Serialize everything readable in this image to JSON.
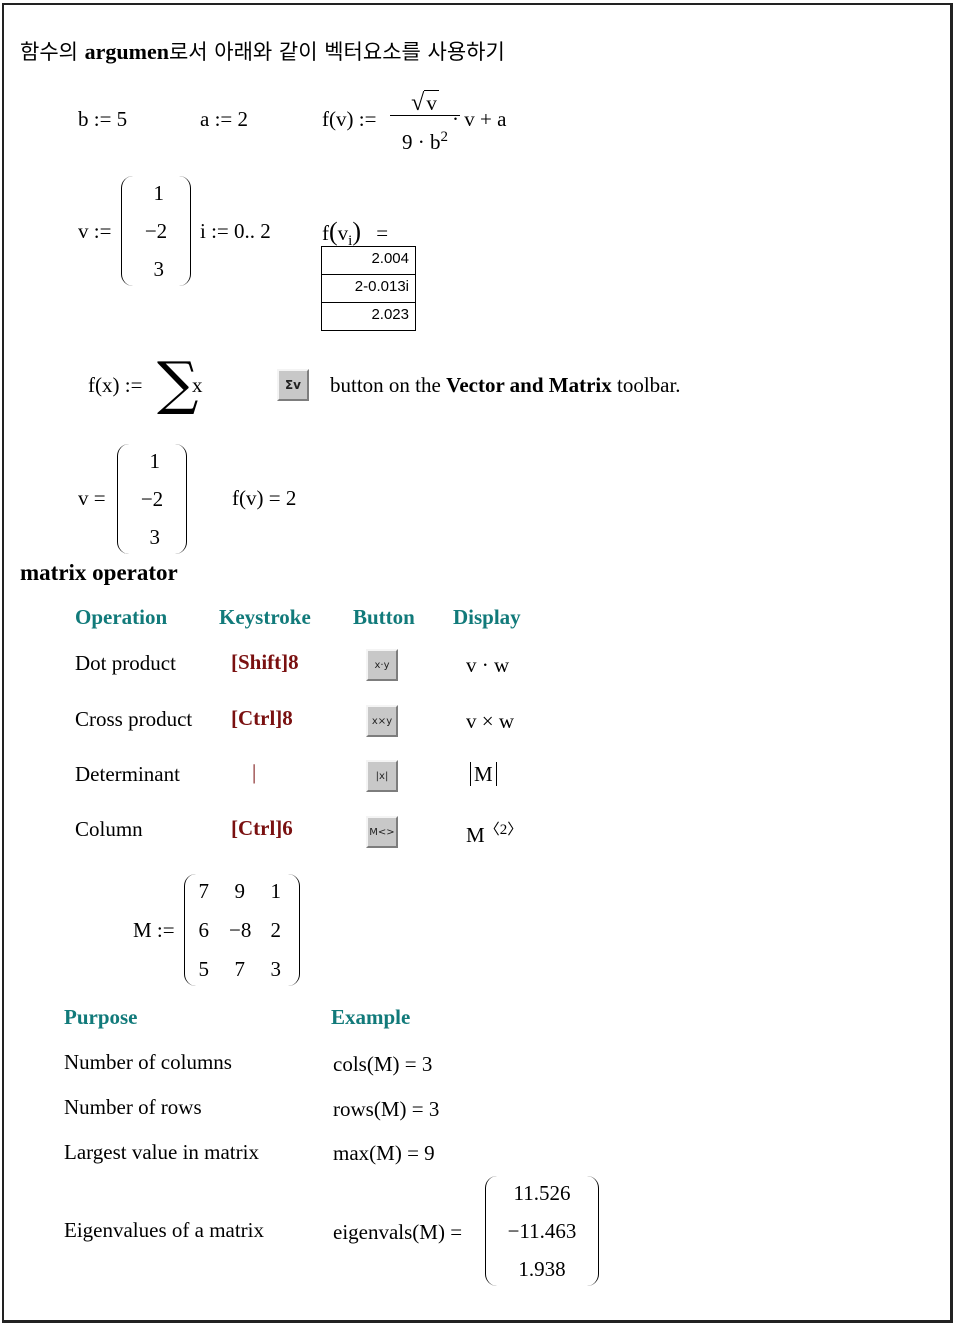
{
  "heading": {
    "prefix": "함수의 ",
    "bold": "argumen",
    "suffix": "로서 아래와 같이 벡터요소를 사용하기"
  },
  "definitions": {
    "b": "b := 5",
    "a": "a := 2",
    "f_lhs": "f(v) :=",
    "f_num": "v",
    "f_den": "9 · b",
    "f_den_exp": "2",
    "f_tail": "· v + a"
  },
  "vector_def": {
    "lhs": "v :=",
    "values": [
      "1",
      "−2",
      "3"
    ],
    "range": "i := 0.. 2",
    "f_call": "f",
    "f_arg": "v",
    "f_sub": "i",
    "eq": "="
  },
  "results": [
    "2.004",
    "2-0.013i",
    "2.023"
  ],
  "sum_line": {
    "lhs": "f(x) :=",
    "sigma": "∑",
    "var": "x",
    "button_icon": "Σv",
    "text_pre": "button on the ",
    "text_bold": "Vector and Matrix",
    "text_post": " toolbar."
  },
  "vector_eval": {
    "lhs": "v =",
    "values": [
      "1",
      "−2",
      "3"
    ],
    "f_result": "f(v) = 2"
  },
  "section_title": "matrix operator",
  "operators_table": {
    "headers": [
      "Operation",
      "Keystroke",
      "Button",
      "Display"
    ],
    "rows": [
      {
        "operation": "Dot product",
        "keystroke": "[Shift]8",
        "button_icon": "x·y",
        "display": "v · w"
      },
      {
        "operation": "Cross product",
        "keystroke": "[Ctrl]8",
        "button_icon": "x×y",
        "display": "v × w"
      },
      {
        "operation": "Determinant",
        "keystroke": "|",
        "button_icon": "|x|",
        "display": "M"
      },
      {
        "operation": "Column",
        "keystroke": "[Ctrl]6",
        "button_icon": "M<>",
        "display": "M",
        "display_sup": "〈2〉"
      }
    ]
  },
  "matrix_def": {
    "lhs": "M :=",
    "rows": [
      [
        "7",
        "9",
        "1"
      ],
      [
        "6",
        "−8",
        "2"
      ],
      [
        "5",
        "7",
        "3"
      ]
    ]
  },
  "functions_table": {
    "headers": [
      "Purpose",
      "Example"
    ],
    "rows": [
      {
        "purpose": "Number of columns",
        "example": "cols(M) = 3"
      },
      {
        "purpose": "Number of rows",
        "example": "rows(M) = 3"
      },
      {
        "purpose": "Largest value in matrix",
        "example": "max(M) = 9"
      },
      {
        "purpose": "Eigenvalues of a matrix",
        "example": "eigenvals(M) =",
        "vector": [
          "11.526",
          "−11.463",
          "1.938"
        ]
      }
    ]
  },
  "colors": {
    "header_teal": "#117a7a",
    "keystroke_red": "#7a1010",
    "button_gray": "#c8c8c8"
  }
}
